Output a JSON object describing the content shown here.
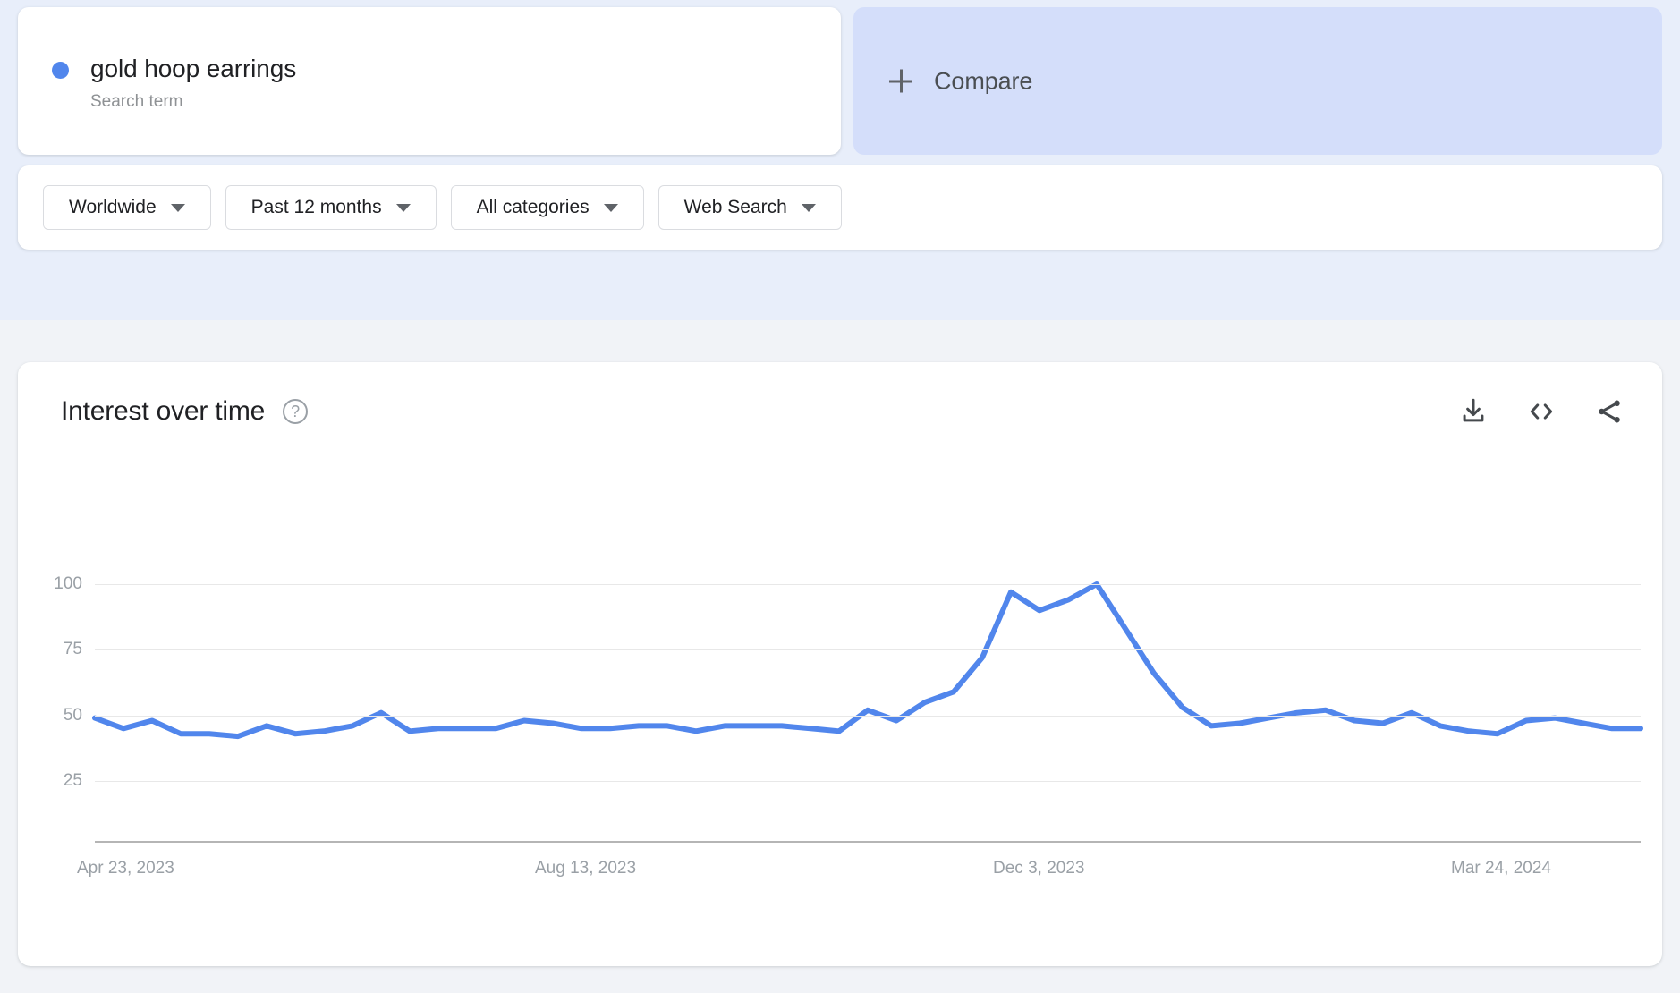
{
  "search": {
    "term": "gold hoop earrings",
    "term_type": "Search term",
    "dot_color": "#5186ec",
    "compare_label": "Compare",
    "compare_icon": "plus-icon",
    "compare_bg": "#d4defa"
  },
  "filters": [
    {
      "label": "Worldwide",
      "icon": "chevron-down-icon"
    },
    {
      "label": "Past 12 months",
      "icon": "chevron-down-icon"
    },
    {
      "label": "All categories",
      "icon": "chevron-down-icon"
    },
    {
      "label": "Web Search",
      "icon": "chevron-down-icon"
    }
  ],
  "chart_panel": {
    "title": "Interest over time",
    "help_icon": "help-circle-icon",
    "help_glyph": "?",
    "actions": [
      {
        "name": "download-icon"
      },
      {
        "name": "embed-code-icon"
      },
      {
        "name": "share-icon"
      }
    ]
  },
  "chart_data": {
    "type": "line",
    "title": "Interest over time",
    "xlabel": "",
    "ylabel": "",
    "ylim": [
      0,
      108
    ],
    "yticks": [
      25,
      50,
      75,
      100
    ],
    "grid": true,
    "legend": "none",
    "line_color": "#5186ec",
    "xtick_labels": [
      "Apr 23, 2023",
      "Aug 13, 2023",
      "Dec 3, 2023",
      "Mar 24, 2024"
    ],
    "xtick_indices": [
      0,
      16,
      32,
      48
    ],
    "series": [
      {
        "name": "gold hoop earrings",
        "color": "#5186ec",
        "values": [
          49,
          45,
          48,
          43,
          43,
          42,
          46,
          43,
          44,
          46,
          51,
          44,
          45,
          45,
          45,
          48,
          47,
          45,
          45,
          46,
          46,
          44,
          46,
          46,
          46,
          45,
          44,
          52,
          48,
          55,
          59,
          72,
          97,
          90,
          94,
          100,
          83,
          66,
          53,
          46,
          47,
          49,
          51,
          52,
          48,
          47,
          51,
          46,
          44,
          43,
          48,
          49,
          47,
          45,
          45
        ]
      }
    ]
  }
}
